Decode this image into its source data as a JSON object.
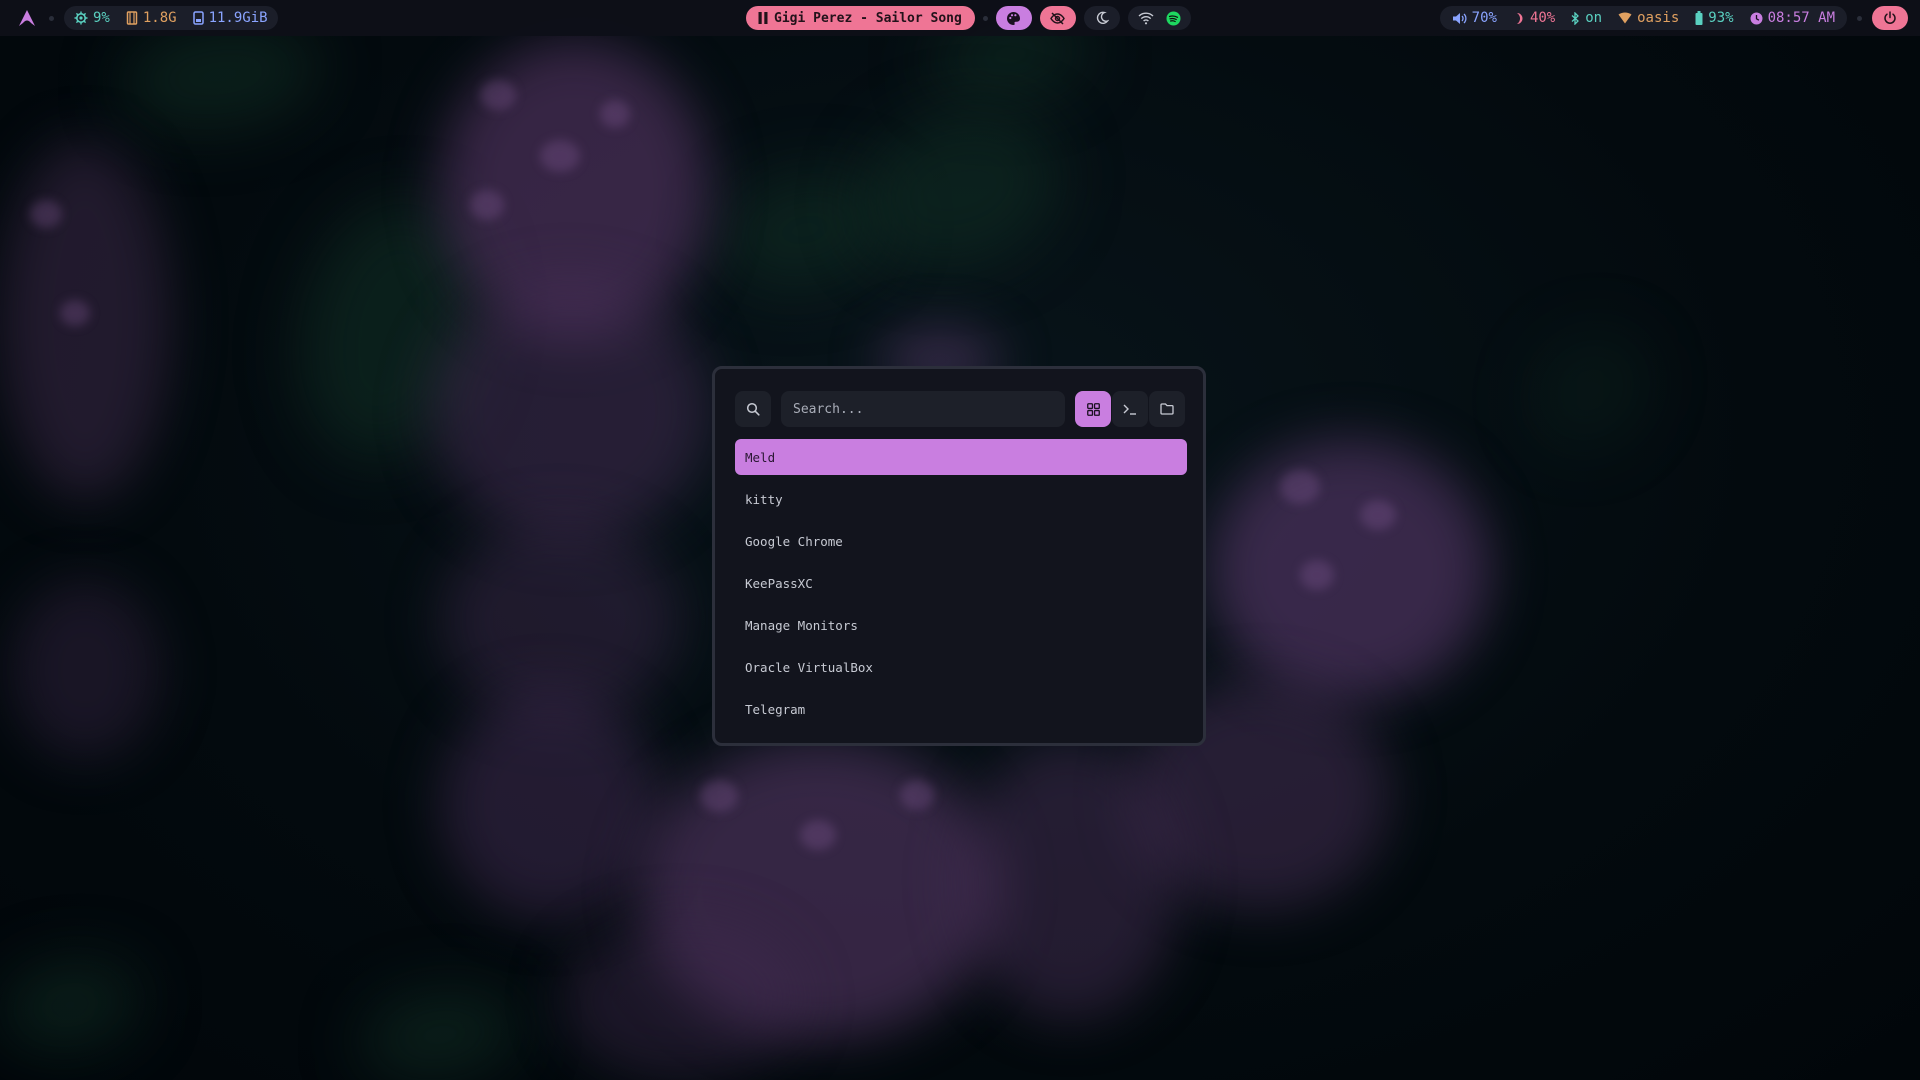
{
  "colors": {
    "accent": "#c97ee0",
    "pink": "#ef7595",
    "teal": "#5ad0c0",
    "orange": "#e0a060",
    "blue": "#8aa4ff",
    "green": "#1ed760",
    "bar_bg": "#0e1018",
    "panel_bg": "#12141d"
  },
  "topbar": {
    "launcher_icon": "arch-logo-icon",
    "cpu": {
      "icon": "cpu-icon",
      "value": "9%"
    },
    "memory": {
      "icon": "memory-icon",
      "value": "1.8G"
    },
    "disk": {
      "icon": "disk-icon",
      "value": "11.9GiB"
    },
    "media": {
      "icon": "pause-icon",
      "title": "Gigi Perez - Sailor Song"
    },
    "theme_icon": "palette-icon",
    "idle_icon": "eye-off-icon",
    "night_icon": "moon-icon",
    "wifi_icon": "wifi-icon",
    "spotify_icon": "spotify-icon",
    "volume": {
      "icon": "speaker-icon",
      "value": "70%"
    },
    "brightness": {
      "icon": "brightness-icon",
      "value": "40%"
    },
    "bluetooth": {
      "icon": "bluetooth-icon",
      "value": "on"
    },
    "network": {
      "icon": "wifi-signal-icon",
      "value": "oasis"
    },
    "battery": {
      "icon": "battery-icon",
      "value": "93%"
    },
    "clock": {
      "icon": "clock-icon",
      "value": "08:57 AM"
    },
    "power_icon": "power-icon"
  },
  "launcher": {
    "search_placeholder": "Search...",
    "search_value": "",
    "modes": [
      "apps-grid-icon",
      "terminal-icon",
      "folder-icon"
    ],
    "active_mode": "apps-grid-icon",
    "apps": [
      {
        "name": "Meld",
        "selected": true
      },
      {
        "name": "kitty",
        "selected": false
      },
      {
        "name": "Google Chrome",
        "selected": false
      },
      {
        "name": "KeePassXC",
        "selected": false
      },
      {
        "name": "Manage Monitors",
        "selected": false
      },
      {
        "name": "Oracle VirtualBox",
        "selected": false
      },
      {
        "name": "Telegram",
        "selected": false
      }
    ]
  }
}
